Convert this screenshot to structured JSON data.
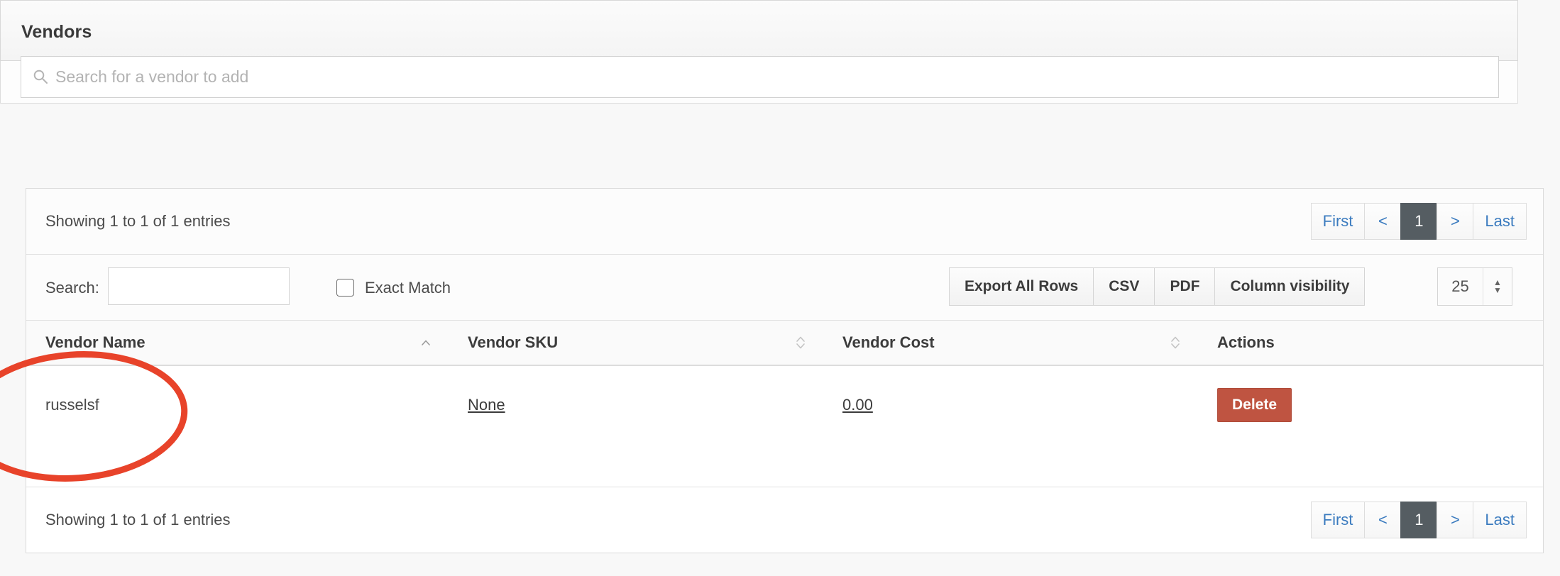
{
  "panel": {
    "title": "Vendors",
    "search": {
      "placeholder": "Search for a vendor to add",
      "value": "",
      "icon": "search-icon"
    }
  },
  "table": {
    "info_top": "Showing 1 to 1 of 1 entries",
    "info_bottom": "Showing 1 to 1 of 1 entries",
    "pagination": {
      "first": "First",
      "prev": "<",
      "current": "1",
      "next": ">",
      "last": "Last",
      "active_color": "#555d62",
      "link_color": "#3b7bbf"
    },
    "filter": {
      "search_label": "Search:",
      "search_value": "",
      "exact_match_label": "Exact Match",
      "exact_match_checked": false
    },
    "buttons": {
      "export_all": "Export All Rows",
      "csv": "CSV",
      "pdf": "PDF",
      "column_visibility": "Column visibility"
    },
    "page_size": {
      "value": "25",
      "spinner_up": "▲",
      "spinner_down": "▼"
    },
    "columns": [
      {
        "label": "Vendor Name",
        "sort": "asc"
      },
      {
        "label": "Vendor SKU",
        "sort": "none"
      },
      {
        "label": "Vendor Cost",
        "sort": "none"
      },
      {
        "label": "Actions",
        "sort": "none"
      }
    ],
    "rows": [
      {
        "vendor_name": "russelsf",
        "vendor_sku": "None",
        "vendor_cost": "0.00",
        "action_label": "Delete"
      }
    ]
  },
  "annotation": {
    "shape": "ellipse",
    "color": "#e8432a",
    "target": "Vendor Name column"
  }
}
